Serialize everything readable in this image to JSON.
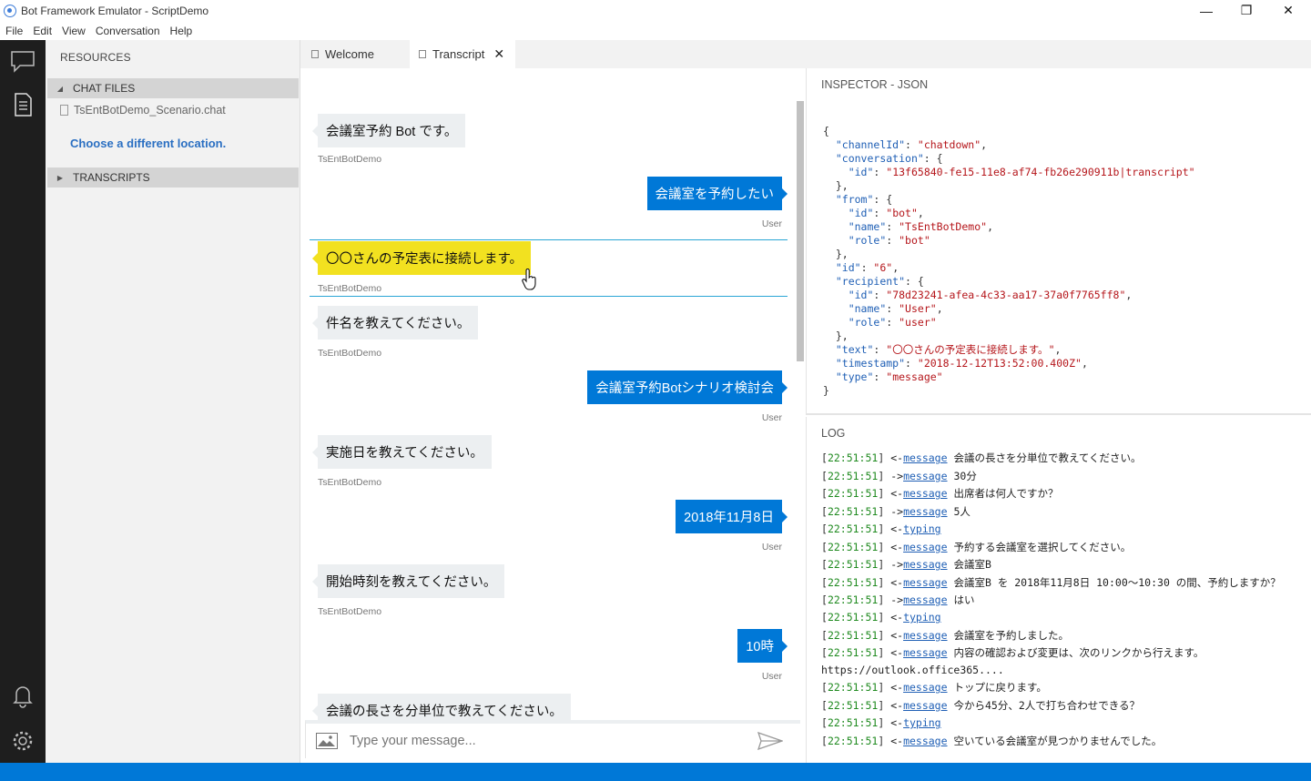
{
  "window": {
    "title": "Bot Framework Emulator - ScriptDemo",
    "controls": {
      "minimize": "—",
      "restore": "❐",
      "close": "✕"
    }
  },
  "menu": [
    "File",
    "Edit",
    "View",
    "Conversation",
    "Help"
  ],
  "sidebar": {
    "title": "RESOURCES",
    "chat_files_label": "CHAT FILES",
    "chat_file": "TsEntBotDemo_Scenario.chat",
    "choose_location": "Choose a different location.",
    "transcripts_label": "TRANSCRIPTS"
  },
  "tabs": [
    {
      "label": "Welcome"
    },
    {
      "label": "Transcript",
      "close": "✕"
    }
  ],
  "chat": {
    "messages": [
      {
        "from": "bot",
        "text": "会議室予約 Bot です。",
        "sender": "TsEntBotDemo"
      },
      {
        "from": "user",
        "text": "会議室を予約したい",
        "sender": "User"
      },
      {
        "from": "bot",
        "text": "〇〇さんの予定表に接続します。",
        "sender": "TsEntBotDemo",
        "highlighted": true
      },
      {
        "from": "bot",
        "text": "件名を教えてください。",
        "sender": "TsEntBotDemo"
      },
      {
        "from": "user",
        "text": "会議室予約Botシナリオ検討会",
        "sender": "User"
      },
      {
        "from": "bot",
        "text": "実施日を教えてください。",
        "sender": "TsEntBotDemo"
      },
      {
        "from": "user",
        "text": "2018年11月8日",
        "sender": "User"
      },
      {
        "from": "bot",
        "text": "開始時刻を教えてください。",
        "sender": "TsEntBotDemo"
      },
      {
        "from": "user",
        "text": "10時",
        "sender": "User"
      },
      {
        "from": "bot",
        "text": "会議の長さを分単位で教えてください。",
        "sender": ""
      }
    ],
    "input_placeholder": "Type your message..."
  },
  "inspector": {
    "title": "INSPECTOR - JSON",
    "json": {
      "channelId": "chatdown",
      "conversation_id": "13f65840-fe15-11e8-af74-fb26e290911b|transcript",
      "from_id": "bot",
      "from_name": "TsEntBotDemo",
      "from_role": "bot",
      "id": "6",
      "recipient_id": "78d23241-afea-4c33-aa17-37a0f7765ff8",
      "recipient_name": "User",
      "recipient_role": "user",
      "text": "〇〇さんの予定表に接続します。",
      "timestamp": "2018-12-12T13:52:00.400Z",
      "type": "message"
    }
  },
  "log": {
    "title": "LOG",
    "lines": [
      {
        "time": "22:51:51",
        "dir": "<-",
        "kind": "message",
        "text": "会議の長さを分単位で教えてください。"
      },
      {
        "time": "22:51:51",
        "dir": "->",
        "kind": "message",
        "text": "30分"
      },
      {
        "time": "22:51:51",
        "dir": "<-",
        "kind": "message",
        "text": "出席者は何人ですか？"
      },
      {
        "time": "22:51:51",
        "dir": "->",
        "kind": "message",
        "text": "5人"
      },
      {
        "time": "22:51:51",
        "dir": "<-",
        "kind": "typing",
        "text": ""
      },
      {
        "time": "22:51:51",
        "dir": "<-",
        "kind": "message",
        "text": "予約する会議室を選択してください。"
      },
      {
        "time": "22:51:51",
        "dir": "->",
        "kind": "message",
        "text": "会議室B"
      },
      {
        "time": "22:51:51",
        "dir": "<-",
        "kind": "message",
        "text": "会議室B を 2018年11月8日 10:00～10:30 の間、予約しますか？",
        "wrap": true
      },
      {
        "time": "22:51:51",
        "dir": "->",
        "kind": "message",
        "text": "はい"
      },
      {
        "time": "22:51:51",
        "dir": "<-",
        "kind": "typing",
        "text": ""
      },
      {
        "time": "22:51:51",
        "dir": "<-",
        "kind": "message",
        "text": "会議室を予約しました。"
      },
      {
        "time": "22:51:51",
        "dir": "<-",
        "kind": "message",
        "text": "内容の確認および変更は、次のリンクから行えます。 https://outlook.office365....",
        "wrap": true
      },
      {
        "time": "22:51:51",
        "dir": "<-",
        "kind": "message",
        "text": "トップに戻ります。"
      },
      {
        "time": "22:51:51",
        "dir": "<-",
        "kind": "message",
        "text": "今から45分、2人で打ち合わせできる？"
      },
      {
        "time": "22:51:51",
        "dir": "<-",
        "kind": "typing",
        "text": ""
      },
      {
        "time": "22:51:51",
        "dir": "<-",
        "kind": "message",
        "text": "空いている会議室が見つかりませんでした。"
      }
    ]
  },
  "colors": {
    "accent": "#0078d7",
    "highlight": "#f2e120",
    "activitybar": "#1e1e1e"
  },
  "icons": [
    "chat-icon",
    "document-icon",
    "bell-icon",
    "gear-icon",
    "monitor-icon",
    "split-view-icon",
    "image-icon",
    "send-icon"
  ]
}
